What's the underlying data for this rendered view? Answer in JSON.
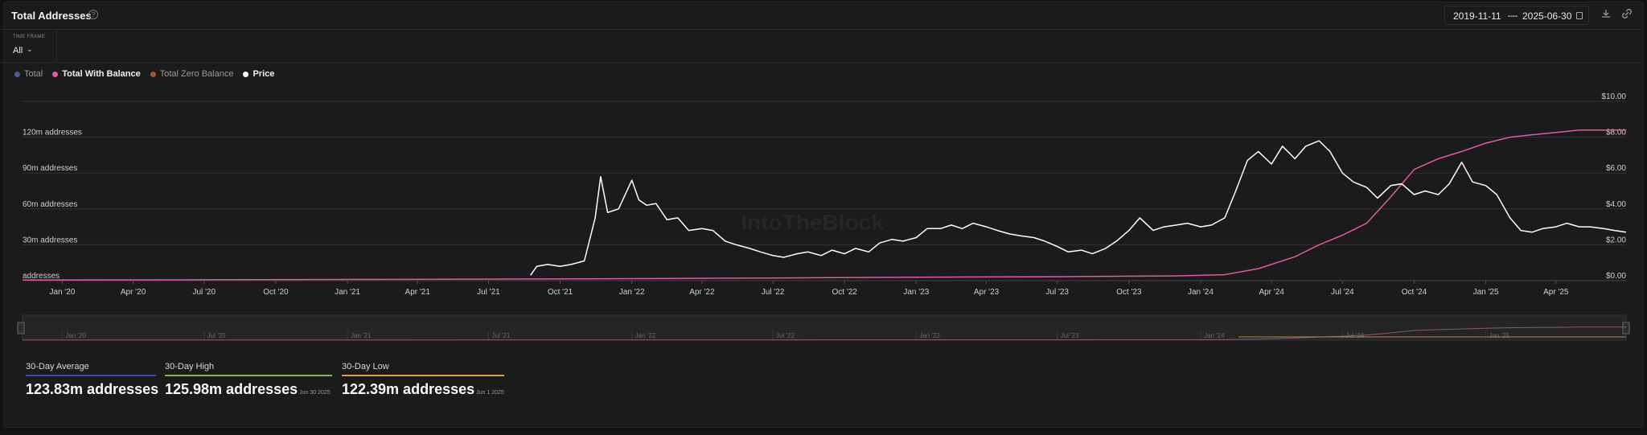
{
  "header": {
    "title": "Total Addresses",
    "help_icon": "help-circle-icon",
    "date_start": "2019-11-11",
    "date_end": "2025-06-30",
    "download_icon": "download-icon",
    "link_icon": "link-icon"
  },
  "timeframe": {
    "label": "TIME FRAME",
    "value": "All"
  },
  "legend": [
    {
      "name": "Total",
      "color": "#4a5ea8",
      "active": false
    },
    {
      "name": "Total With Balance",
      "color": "#e05aa5",
      "active": true
    },
    {
      "name": "Total Zero Balance",
      "color": "#9a5a3a",
      "active": false
    },
    {
      "name": "Price",
      "color": "#ffffff",
      "active": true
    }
  ],
  "watermark": "IntoTheBlock",
  "chart_data": {
    "type": "line",
    "x_ticks": [
      "Jan '20",
      "Apr '20",
      "Jul '20",
      "Oct '20",
      "Jan '21",
      "Apr '21",
      "Jul '21",
      "Oct '21",
      "Jan '22",
      "Apr '22",
      "Jul '22",
      "Oct '22",
      "Jan '23",
      "Apr '23",
      "Jul '23",
      "Oct '23",
      "Jan '24",
      "Apr '24",
      "Jul '24",
      "Oct '24",
      "Jan '25",
      "Apr '25"
    ],
    "y_left_ticks": [
      "addresses",
      "30m addresses",
      "60m addresses",
      "90m addresses",
      "120m addresses"
    ],
    "y_right_ticks": [
      "$0.00",
      "$2.00",
      "$4.00",
      "$6.00",
      "$8.00",
      "$10.00"
    ],
    "y_left_range": [
      0,
      150
    ],
    "y_right_range": [
      0,
      10
    ],
    "x_range": [
      "2019-11-11",
      "2025-06-30"
    ],
    "series": [
      {
        "name": "Total With Balance",
        "axis": "left",
        "color": "#e05aa5",
        "x": [
          "2019-11-11",
          "2020-06-01",
          "2021-01-01",
          "2021-07-01",
          "2022-01-01",
          "2022-07-01",
          "2023-01-01",
          "2023-07-01",
          "2023-12-01",
          "2024-02-01",
          "2024-03-15",
          "2024-05-01",
          "2024-06-01",
          "2024-07-01",
          "2024-08-01",
          "2024-09-01",
          "2024-10-01",
          "2024-11-01",
          "2024-12-01",
          "2025-01-01",
          "2025-02-01",
          "2025-03-01",
          "2025-04-01",
          "2025-05-01",
          "2025-06-30"
        ],
        "values": [
          0.5,
          0.7,
          1,
          1.3,
          1.7,
          2.2,
          2.8,
          3.3,
          4,
          5,
          10,
          20,
          30,
          38,
          48,
          70,
          93,
          102,
          108,
          115,
          120,
          122,
          124,
          126,
          126
        ]
      },
      {
        "name": "Price",
        "axis": "right",
        "color": "#ffffff",
        "x": [
          "2021-08-24",
          "2021-09-01",
          "2021-09-15",
          "2021-10-01",
          "2021-10-15",
          "2021-11-01",
          "2021-11-15",
          "2021-11-22",
          "2021-12-01",
          "2021-12-15",
          "2022-01-01",
          "2022-01-10",
          "2022-01-20",
          "2022-02-01",
          "2022-02-15",
          "2022-03-01",
          "2022-03-15",
          "2022-04-01",
          "2022-04-15",
          "2022-05-01",
          "2022-05-15",
          "2022-06-01",
          "2022-06-15",
          "2022-07-01",
          "2022-07-15",
          "2022-08-01",
          "2022-08-15",
          "2022-09-01",
          "2022-09-15",
          "2022-10-01",
          "2022-10-15",
          "2022-11-01",
          "2022-11-15",
          "2022-12-01",
          "2022-12-15",
          "2023-01-01",
          "2023-01-15",
          "2023-02-01",
          "2023-02-15",
          "2023-03-01",
          "2023-03-15",
          "2023-04-01",
          "2023-04-15",
          "2023-05-01",
          "2023-05-15",
          "2023-06-01",
          "2023-06-15",
          "2023-07-01",
          "2023-07-15",
          "2023-08-01",
          "2023-08-15",
          "2023-09-01",
          "2023-09-15",
          "2023-10-01",
          "2023-10-15",
          "2023-11-01",
          "2023-11-15",
          "2023-12-01",
          "2023-12-15",
          "2024-01-01",
          "2024-01-15",
          "2024-02-01",
          "2024-02-15",
          "2024-03-01",
          "2024-03-15",
          "2024-04-01",
          "2024-04-15",
          "2024-05-01",
          "2024-05-15",
          "2024-06-01",
          "2024-06-15",
          "2024-07-01",
          "2024-07-15",
          "2024-08-01",
          "2024-08-15",
          "2024-09-01",
          "2024-09-15",
          "2024-10-01",
          "2024-10-15",
          "2024-11-01",
          "2024-11-15",
          "2024-12-01",
          "2024-12-15",
          "2025-01-01",
          "2025-01-15",
          "2025-02-01",
          "2025-02-15",
          "2025-03-01",
          "2025-03-15",
          "2025-04-01",
          "2025-04-15",
          "2025-05-01",
          "2025-05-15",
          "2025-06-01",
          "2025-06-15",
          "2025-06-30"
        ],
        "values": [
          0.3,
          0.8,
          0.9,
          0.8,
          0.9,
          1.1,
          3.5,
          5.8,
          3.8,
          4.0,
          5.6,
          4.5,
          4.2,
          4.3,
          3.4,
          3.5,
          2.8,
          2.9,
          2.8,
          2.2,
          2.0,
          1.8,
          1.6,
          1.4,
          1.3,
          1.5,
          1.6,
          1.4,
          1.7,
          1.5,
          1.8,
          1.6,
          2.1,
          2.3,
          2.2,
          2.4,
          2.9,
          2.9,
          3.1,
          2.9,
          3.2,
          3.0,
          2.8,
          2.6,
          2.5,
          2.4,
          2.2,
          1.9,
          1.6,
          1.7,
          1.5,
          1.8,
          2.2,
          2.8,
          3.5,
          2.8,
          3.0,
          3.1,
          3.2,
          3.0,
          3.1,
          3.5,
          5.0,
          6.7,
          7.2,
          6.5,
          7.5,
          6.8,
          7.5,
          7.8,
          7.2,
          6.0,
          5.5,
          5.2,
          4.6,
          5.3,
          5.4,
          4.8,
          5.0,
          4.8,
          5.4,
          6.6,
          5.5,
          5.3,
          4.8,
          3.5,
          2.8,
          2.7,
          2.9,
          3.0,
          3.2,
          3.0,
          3.0,
          2.9,
          2.8,
          2.7
        ]
      }
    ],
    "navigator_ticks": [
      "Jan '20",
      "Jul '20",
      "Jan '21",
      "Jul '21",
      "Jan '22",
      "Jul '22",
      "Jan '23",
      "Jul '23",
      "Jan '24",
      "Jul '24",
      "Jan '25"
    ]
  },
  "stats": [
    {
      "label": "30-Day Average",
      "value": "123.83m addresses",
      "date": "",
      "color": "#3448b8"
    },
    {
      "label": "30-Day High",
      "value": "125.98m addresses",
      "date": "Jun 30 2025",
      "color": "#7fb55a"
    },
    {
      "label": "30-Day Low",
      "value": "122.39m addresses",
      "date": "Jun 1 2025",
      "color": "#d8a23a"
    }
  ]
}
